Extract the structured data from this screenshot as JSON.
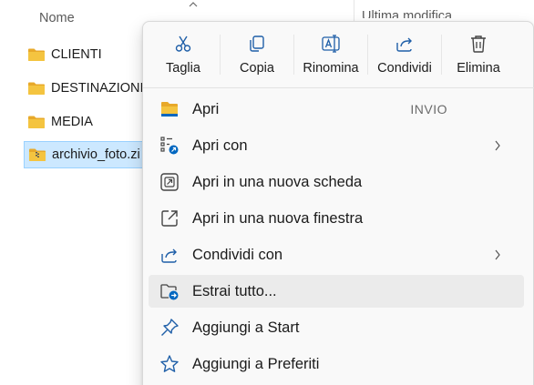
{
  "explorer": {
    "columns": {
      "name": "Nome",
      "modified": "Ultima modifica"
    },
    "files": [
      {
        "name": "CLIENTI",
        "type": "folder"
      },
      {
        "name": "DESTINAZIONI",
        "type": "folder"
      },
      {
        "name": "MEDIA",
        "type": "folder"
      },
      {
        "name": "archivio_foto.zi",
        "type": "zip",
        "selected": true
      }
    ]
  },
  "context_menu": {
    "toolbar": [
      {
        "label": "Taglia",
        "icon": "scissors-icon"
      },
      {
        "label": "Copia",
        "icon": "copy-icon"
      },
      {
        "label": "Rinomina",
        "icon": "rename-icon"
      },
      {
        "label": "Condividi",
        "icon": "share-icon"
      },
      {
        "label": "Elimina",
        "icon": "trash-icon"
      }
    ],
    "items": [
      {
        "label": "Apri",
        "accelerator": "INVIO",
        "icon": "folder-open-icon"
      },
      {
        "label": "Apri con",
        "icon": "open-with-icon",
        "submenu": true
      },
      {
        "label": "Apri in una nuova scheda",
        "icon": "new-tab-icon"
      },
      {
        "label": "Apri in una nuova finestra",
        "icon": "new-window-icon"
      },
      {
        "label": "Condividi con",
        "icon": "share-with-icon",
        "submenu": true
      },
      {
        "label": "Estrai tutto...",
        "icon": "extract-all-icon",
        "highlighted": true
      },
      {
        "label": "Aggiungi a Start",
        "icon": "pin-icon"
      },
      {
        "label": "Aggiungi a Preferiti",
        "icon": "star-icon"
      }
    ]
  },
  "colors": {
    "accent": "#0067c0",
    "folder_yellow": "#f4c440",
    "selection_bg": "#cce8ff",
    "menu_bg": "#f9f9f9",
    "hover_bg": "#ebebeb"
  }
}
